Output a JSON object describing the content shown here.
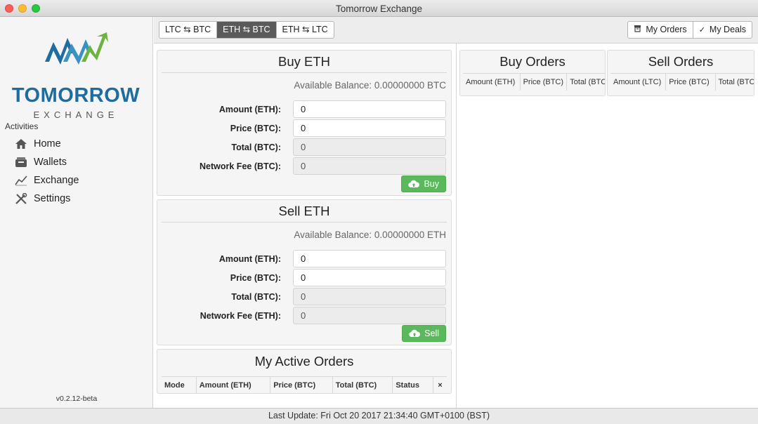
{
  "window": {
    "title": "Tomorrow Exchange"
  },
  "brand": {
    "name": "TOMORROW",
    "sub": "EXCHANGE",
    "color_blue": "#1f6c9e",
    "color_green": "#6db33f"
  },
  "sidebar": {
    "heading": "Activities",
    "items": [
      {
        "label": "Home",
        "icon": "home-icon"
      },
      {
        "label": "Wallets",
        "icon": "wallet-icon"
      },
      {
        "label": "Exchange",
        "icon": "chart-line-icon"
      },
      {
        "label": "Settings",
        "icon": "tools-icon"
      }
    ],
    "version": "v0.2.12-beta"
  },
  "toolbar": {
    "pairs": [
      {
        "label": "LTC ⇆ BTC",
        "active": false
      },
      {
        "label": "ETH ⇆ BTC",
        "active": true
      },
      {
        "label": "ETH ⇆ LTC",
        "active": false
      }
    ],
    "my_orders": "My Orders",
    "my_deals": "My Deals"
  },
  "buy": {
    "title": "Buy ETH",
    "balance": "Available Balance: 0.00000000 BTC",
    "fields": [
      {
        "label": "Amount (ETH):",
        "value": "0",
        "readonly": false
      },
      {
        "label": "Price (BTC):",
        "value": "0",
        "readonly": false
      },
      {
        "label": "Total (BTC):",
        "value": "0",
        "readonly": true
      },
      {
        "label": "Network Fee (BTC):",
        "value": "0",
        "readonly": true
      }
    ],
    "button": "Buy"
  },
  "sell": {
    "title": "Sell ETH",
    "balance": "Available Balance: 0.00000000 ETH",
    "fields": [
      {
        "label": "Amount (ETH):",
        "value": "0",
        "readonly": false
      },
      {
        "label": "Price (BTC):",
        "value": "0",
        "readonly": false
      },
      {
        "label": "Total (BTC):",
        "value": "0",
        "readonly": true
      },
      {
        "label": "Network Fee (ETH):",
        "value": "0",
        "readonly": true
      }
    ],
    "button": "Sell"
  },
  "active_orders": {
    "title": "My Active Orders",
    "columns": [
      "Mode",
      "Amount (ETH)",
      "Price (BTC)",
      "Total (BTC)",
      "Status",
      "×"
    ]
  },
  "buy_orders": {
    "title": "Buy Orders",
    "columns": [
      "Amount (ETH)",
      "Price (BTC)",
      "Total (BTC)"
    ]
  },
  "sell_orders": {
    "title": "Sell Orders",
    "columns": [
      "Amount (LTC)",
      "Price (BTC)",
      "Total (BTC)"
    ]
  },
  "status": {
    "last_update": "Last Update: Fri Oct 20 2017 21:34:40 GMT+0100 (BST)"
  },
  "colors": {
    "accent_green": "#5cb85c",
    "active_segment": "#5a5a5a"
  }
}
